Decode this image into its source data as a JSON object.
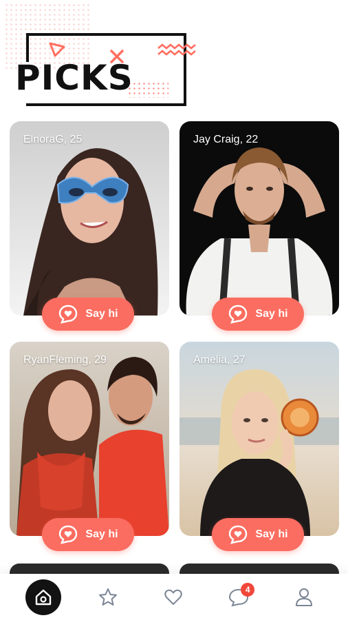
{
  "header": {
    "title": "PICKS"
  },
  "cards": [
    {
      "name": "ElnoraG, 25",
      "cta": "Say hi"
    },
    {
      "name": "Jay Craig, 22",
      "cta": "Say hi"
    },
    {
      "name": "RyanFleming, 29",
      "cta": "Say hi"
    },
    {
      "name": "Amelia, 27",
      "cta": "Say hi"
    }
  ],
  "nav": {
    "items": [
      "home-icon",
      "star-icon",
      "heart-icon",
      "chat-icon",
      "profile-icon"
    ],
    "chat_badge": "4"
  },
  "colors": {
    "accent": "#fa6d60",
    "badge": "#f0473a",
    "dark": "#121212"
  }
}
